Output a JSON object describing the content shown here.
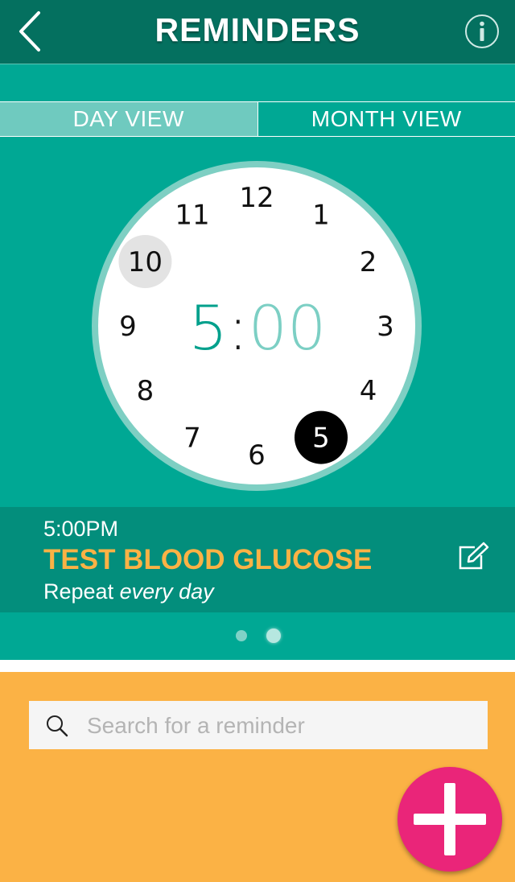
{
  "header": {
    "title": "REMINDERS",
    "back_icon": "chevron-left-icon",
    "info_icon": "info-icon"
  },
  "tabs": [
    {
      "label": "DAY VIEW",
      "active": true
    },
    {
      "label": "MONTH VIEW",
      "active": false
    }
  ],
  "clock": {
    "hours": [
      "12",
      "1",
      "2",
      "3",
      "4",
      "5",
      "6",
      "7",
      "8",
      "9",
      "10",
      "11"
    ],
    "selected_hour": "5",
    "highlighted_hour": "10",
    "time_hour": "5",
    "time_sep": ":",
    "time_minutes": "00"
  },
  "reminder": {
    "time": "5:00PM",
    "title": "TEST BLOOD GLUCOSE",
    "repeat_prefix": "Repeat",
    "repeat_value": "every day",
    "edit_icon": "edit-icon"
  },
  "pager": {
    "count": 2,
    "active_index": 1
  },
  "search": {
    "placeholder": "Search for a reminder",
    "value": "",
    "icon": "search-icon"
  },
  "add_button": {
    "icon": "plus-icon"
  },
  "colors": {
    "header": "#04705f",
    "teal": "#00a894",
    "card": "#038e7c",
    "accent_orange": "#fbb245",
    "add_pink": "#ea2579",
    "hour_teal": "#00a08c",
    "minute_teal": "#7ccfc4"
  }
}
